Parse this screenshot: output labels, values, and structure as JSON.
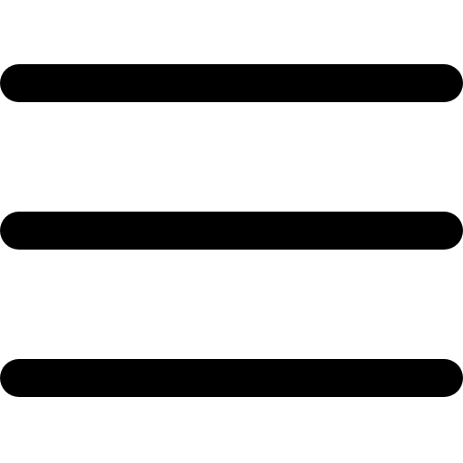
{
  "icon": {
    "name": "hamburger-menu-icon",
    "color": "#000000",
    "background": "#ffffff"
  }
}
